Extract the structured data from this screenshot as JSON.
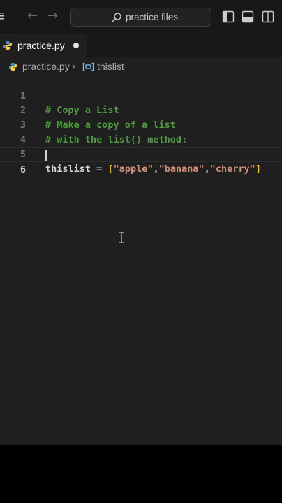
{
  "titlebar": {
    "search_label": "practice files",
    "icons": [
      "menu-icon",
      "back-arrow-icon",
      "forward-arrow-icon",
      "search-icon",
      "toggle-primary-sidebar-icon",
      "toggle-panel-icon",
      "toggle-secondary-sidebar-icon"
    ],
    "back_arrow": "←",
    "forward_arrow": "→"
  },
  "tab": {
    "label": "practice.py",
    "modified": true
  },
  "breadcrumb": {
    "file": "practice.py",
    "separator": "›",
    "symbol": "thislist"
  },
  "editor": {
    "lines": [
      {
        "number": "1",
        "text": "# Copy a List"
      },
      {
        "number": "2",
        "text": "# Make a copy of a list"
      },
      {
        "number": "3",
        "text": "# with the list() method:"
      },
      {
        "number": "4",
        "text": ""
      },
      {
        "number": "5",
        "tokens": {
          "ident": "thislist",
          "op": " = ",
          "open": "[",
          "s1": "\"apple\"",
          "c1": ",",
          "s2": "\"banana\"",
          "c2": ",",
          "s3": "\"cherry\"",
          "close": "]"
        }
      },
      {
        "number": "6",
        "text": ""
      }
    ],
    "active_line": "6"
  },
  "colors": {
    "comment": "#4e9a3e",
    "string": "#ce9178",
    "bracket": "#f1c40f",
    "accent": "#0078d4"
  }
}
